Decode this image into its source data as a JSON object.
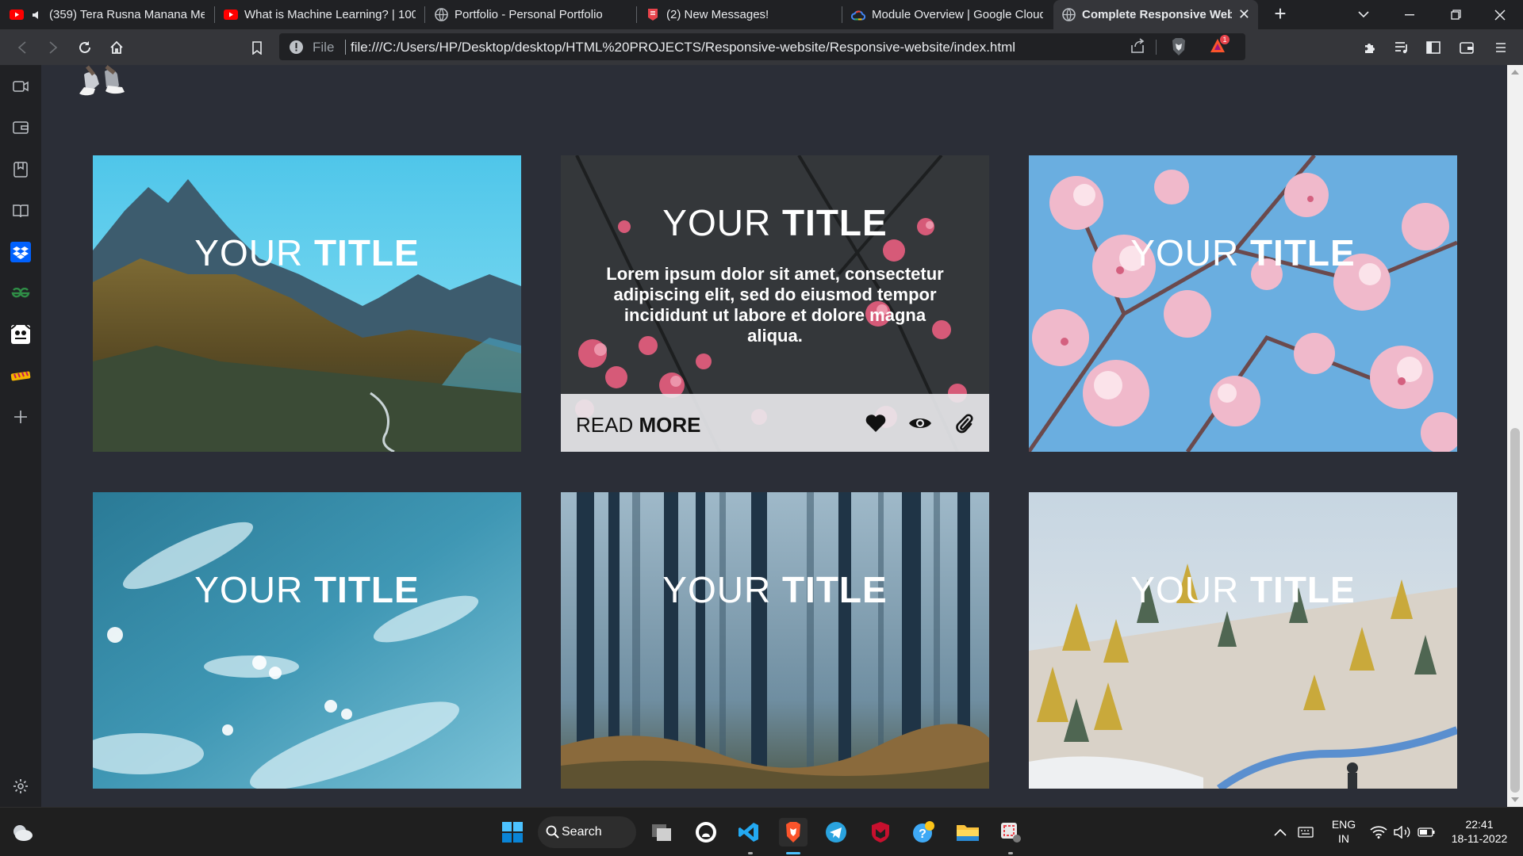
{
  "browser": {
    "tabs": [
      {
        "title": "(359) Tera Rusna Manana Me",
        "favicon": "youtube-icon",
        "muted": true
      },
      {
        "title": "What is Machine Learning? | 100",
        "favicon": "youtube-icon"
      },
      {
        "title": "Portfolio - Personal Portfolio",
        "favicon": "globe-icon"
      },
      {
        "title": "(2) New Messages!",
        "favicon": "mail-icon"
      },
      {
        "title": "Module Overview | Google Cloud",
        "favicon": "google-cloud-icon"
      },
      {
        "title": "Complete Responsive Websi",
        "favicon": "globe-icon",
        "active": true
      }
    ],
    "address": {
      "scheme_label": "File",
      "url": "file:///C:/Users/HP/Desktop/desktop/HTML%20PROJECTS/Responsive-website/Responsive-website/index.html"
    },
    "rewards_badge": "1"
  },
  "sidebar": {
    "items": [
      "video-call-icon",
      "wallet-icon",
      "bookmarks-icon",
      "reading-list-icon",
      "dropbox-icon",
      "geeksforgeeks-icon",
      "app-icon",
      "extension-icon",
      "add-icon",
      "settings-icon"
    ]
  },
  "cards": [
    {
      "title_light": "YOUR ",
      "title_bold": "TITLE",
      "scene": "mountain-forest"
    },
    {
      "title_light": "YOUR ",
      "title_bold": "TITLE",
      "scene": "pink-blossom-dark",
      "description": "Lorem ipsum dolor sit amet, consectetur adipiscing elit, sed do eiusmod tempor incididunt ut labore et dolore magna aliqua.",
      "read_more_light": "READ ",
      "read_more_bold": "MORE"
    },
    {
      "title_light": "YOUR ",
      "title_bold": "TITLE",
      "scene": "cherry-blossom-sky"
    },
    {
      "title_light": "YOUR ",
      "title_bold": "TITLE",
      "scene": "blue-clouds"
    },
    {
      "title_light": "YOUR ",
      "title_bold": "TITLE",
      "scene": "misty-forest"
    },
    {
      "title_light": "YOUR ",
      "title_bold": "TITLE",
      "scene": "autumn-hillside"
    }
  ],
  "taskbar": {
    "search_label": "Search",
    "language": "ENG",
    "region": "IN",
    "time": "22:41",
    "date": "18-11-2022"
  },
  "colors": {
    "page_bg": "#2b2e37",
    "chrome_dark": "#202124",
    "chrome_toolbar": "#35363a",
    "brave_orange": "#fb542b"
  }
}
